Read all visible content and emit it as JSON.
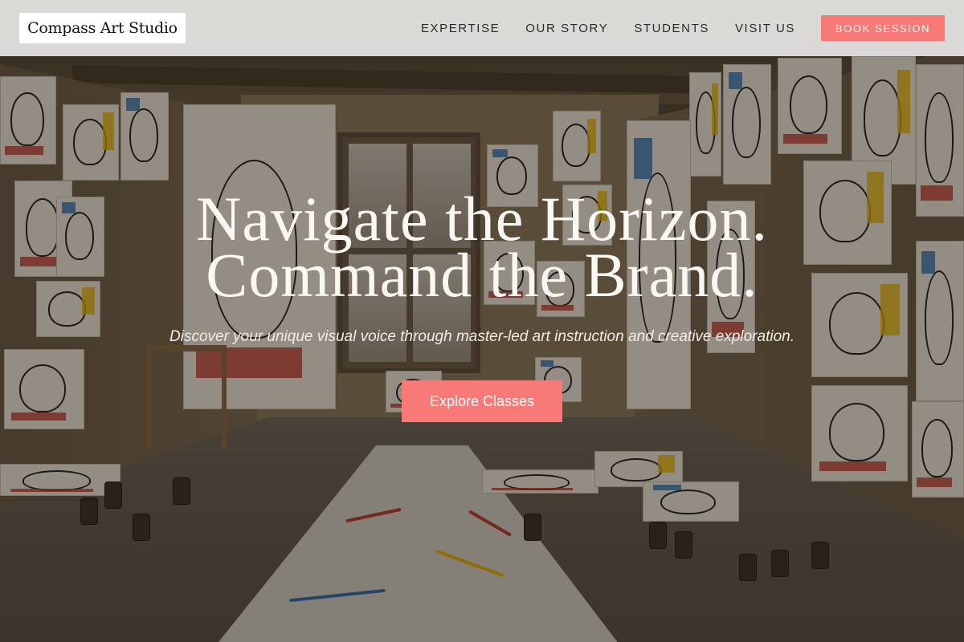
{
  "brand": {
    "name": "Compass Art Studio"
  },
  "nav": {
    "links": [
      "EXPERTISE",
      "OUR STORY",
      "STUDENTS",
      "VISIT US"
    ],
    "cta_label": "BOOK SESSION"
  },
  "hero": {
    "headline_line1": "Navigate the Horizon.",
    "headline_line2": "Command the Brand.",
    "subheadline": "Discover your unique visual voice through master-led art instruction and creative exploration.",
    "cta_label": "Explore Classes",
    "background": "art-studio-photo"
  },
  "colors": {
    "accent": "#f87a78",
    "nav_background": "#e4e4e2",
    "hero_text": "#fbf8f4"
  }
}
